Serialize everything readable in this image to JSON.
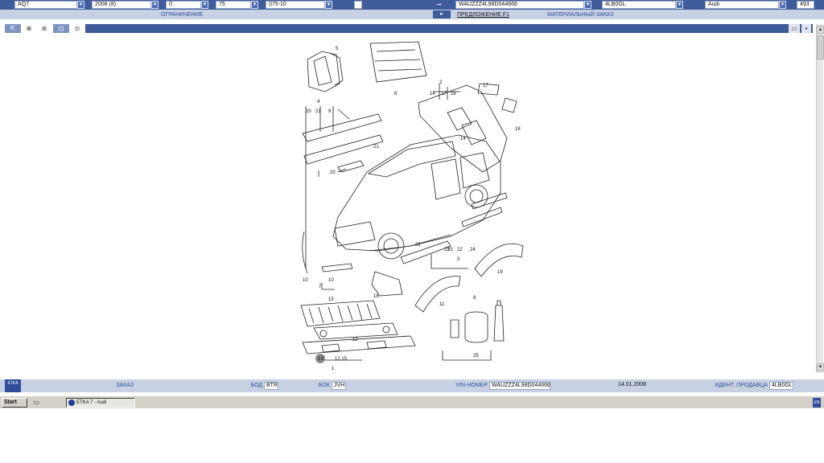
{
  "top_bar": {
    "model": "AQ7",
    "year": "2008 (8)",
    "field3": "0",
    "field4": "75",
    "catalog": "075-10",
    "vin": "WAUZZZ4L98D044666",
    "code": "4LB0GL",
    "brand": "Audi",
    "number": "493"
  },
  "sub_bar": {
    "restriction": "ОГРАНИЧЕНИЕ",
    "proposal": "ПРЕДЛОЖЕНИЕ F1",
    "material_order": "МАТЕРИАЛЬНЫЙ ЗАКАЗ"
  },
  "drawing": {
    "callouts": [
      "5",
      "6",
      "2",
      "14",
      "17",
      "18",
      "17",
      "4",
      "20",
      "21",
      "9",
      "18",
      "21",
      "14",
      "20",
      "22",
      "23",
      "22",
      "24",
      "23",
      "3",
      "10",
      "10",
      "7",
      "16",
      "19",
      "15",
      "11",
      "8",
      "12",
      "13",
      "12,15",
      "1",
      "25"
    ]
  },
  "status_bar": {
    "logo": "ETKA",
    "order_label": "ЗАКАЗ",
    "bod_label": "БОД",
    "bod_value": "BTR",
    "bok_label": "БОК",
    "bok_value": "JVH",
    "vin_label": "VIN-НОМЕР",
    "vin_value": "WAUZZZ4L98D044666",
    "date": "14.01.2008",
    "dealer_label": "ИДЕНТ. ПРОДАВЦА",
    "dealer_value": "4LB0GL"
  },
  "taskbar": {
    "start": "Start",
    "task": "ETKA 7 - Audi",
    "tray": "EN"
  },
  "colors": {
    "bar_blue": "#3e5b9a",
    "bar_light": "#c8d0e3",
    "link_blue": "#2f4f9b"
  }
}
